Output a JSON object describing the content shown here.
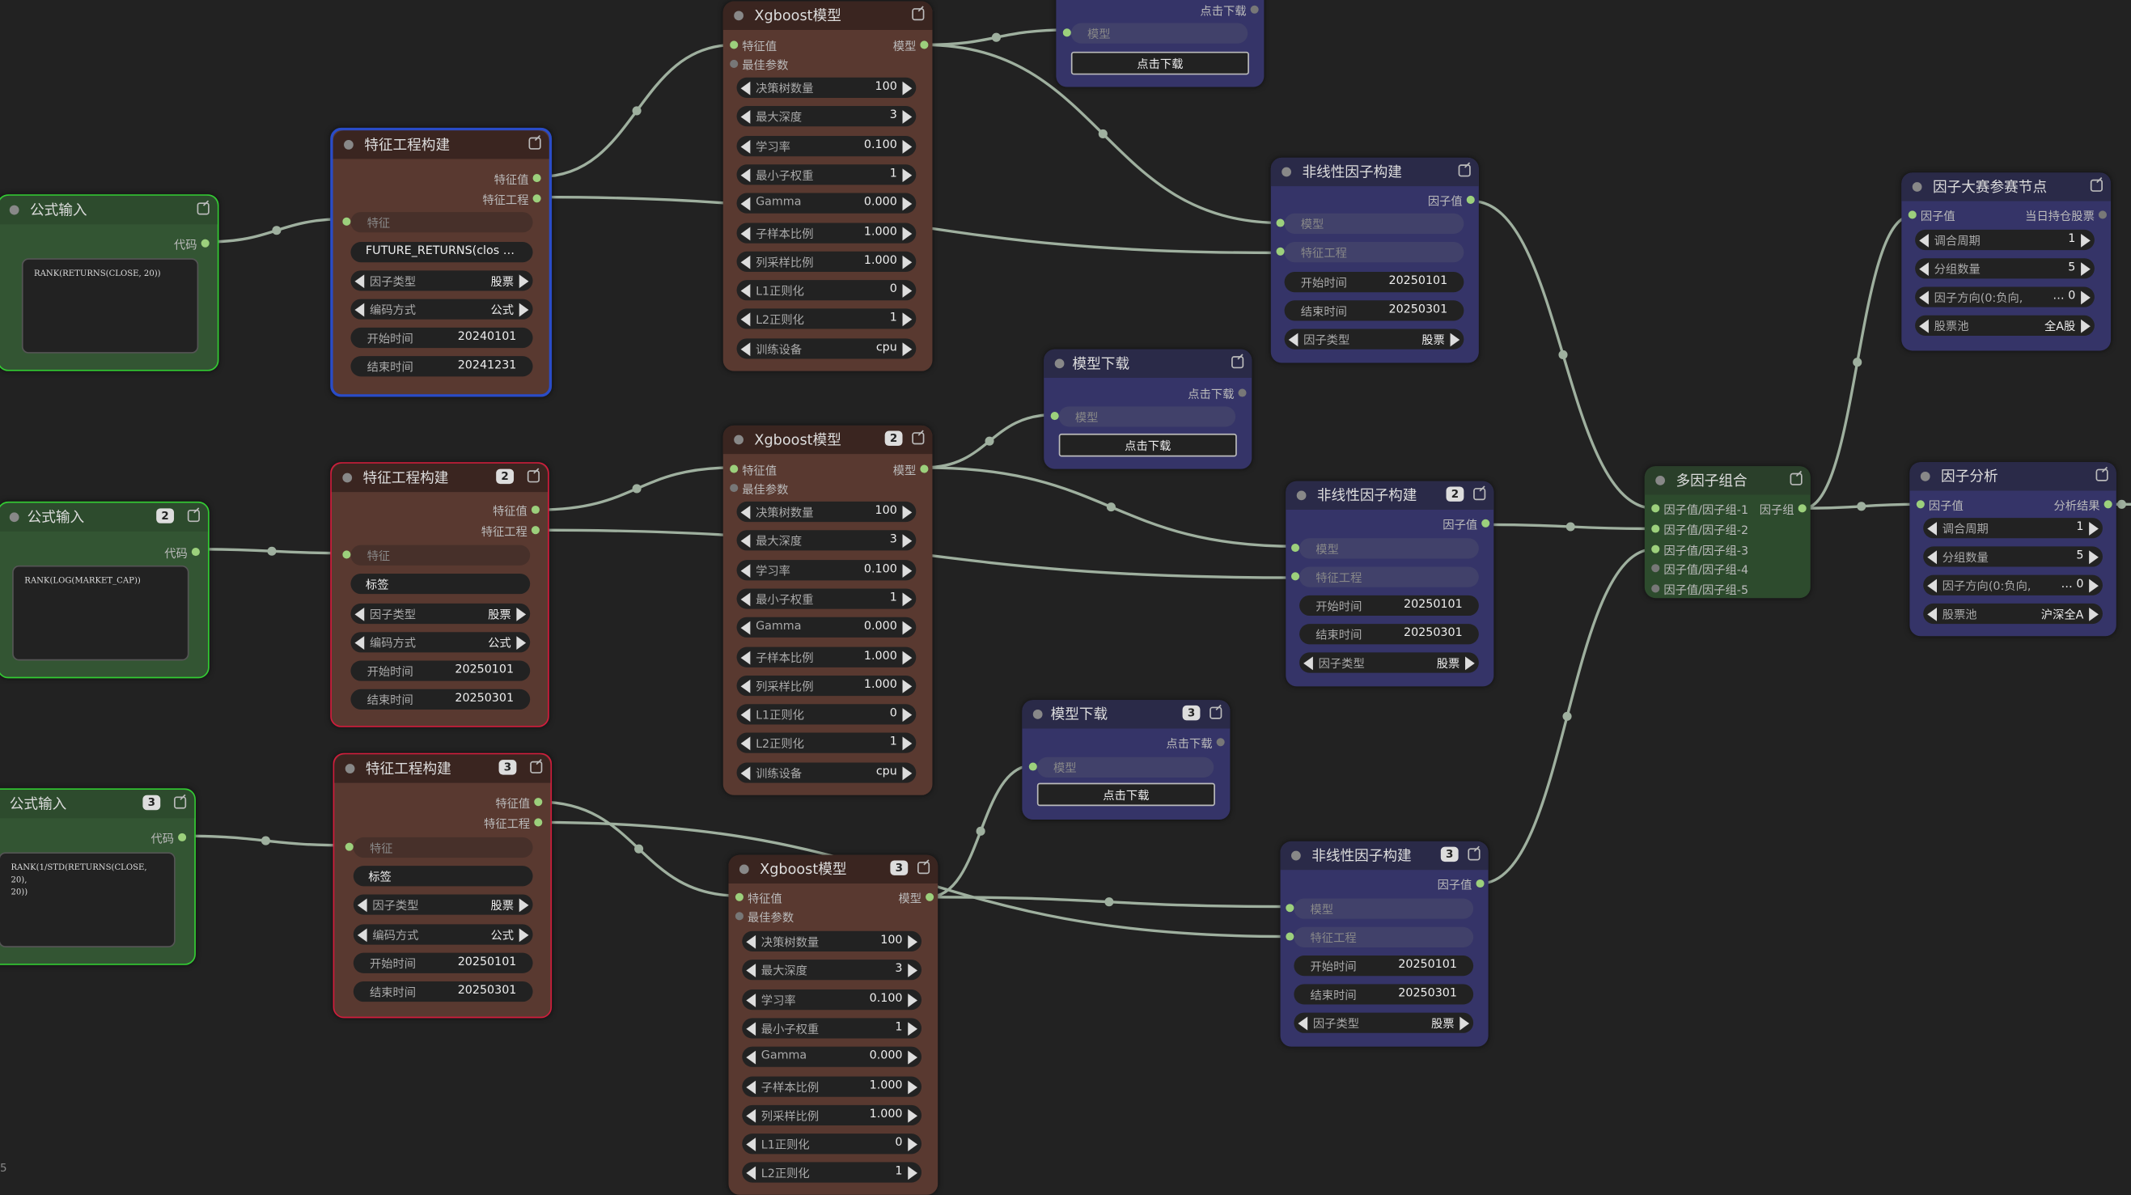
{
  "nodes": {
    "formula1": {
      "title": "公式输入",
      "out_code": "代码",
      "code": "RANK(RETURNS(CLOSE, 20))"
    },
    "formula2": {
      "title": "公式输入",
      "badge": "2",
      "out_code": "代码",
      "code": "RANK(LOG(MARKET_CAP))"
    },
    "formula3": {
      "title": "公式输入",
      "badge": "3",
      "out_code": "代码",
      "code": "RANK(1/STD(RETURNS(CLOSE, 20),\n20))"
    },
    "fe1": {
      "title": "特征工程构建",
      "out_feature": "特征值",
      "out_eng": "特征工程",
      "in_feature": "特征",
      "label_value": "FUTURE_RETURNS(clos …",
      "w_type_label": "因子类型",
      "w_type_value": "股票",
      "w_enc_label": "编码方式",
      "w_enc_value": "公式",
      "w_start_label": "开始时间",
      "w_start_value": "20240101",
      "w_end_label": "结束时间",
      "w_end_value": "20241231"
    },
    "fe2": {
      "title": "特征工程构建",
      "badge": "2",
      "out_feature": "特征值",
      "out_eng": "特征工程",
      "in_feature": "特征",
      "label_value": "标签",
      "w_type_label": "因子类型",
      "w_type_value": "股票",
      "w_enc_label": "编码方式",
      "w_enc_value": "公式",
      "w_start_label": "开始时间",
      "w_start_value": "20250101",
      "w_end_label": "结束时间",
      "w_end_value": "20250301"
    },
    "fe3": {
      "title": "特征工程构建",
      "badge": "3",
      "out_feature": "特征值",
      "out_eng": "特征工程",
      "in_feature": "特征",
      "label_value": "标签",
      "w_type_label": "因子类型",
      "w_type_value": "股票",
      "w_enc_label": "编码方式",
      "w_enc_value": "公式",
      "w_start_label": "开始时间",
      "w_start_value": "20250101",
      "w_end_label": "结束时间",
      "w_end_value": "20250301"
    },
    "xgb1": {
      "title": "Xgboost模型",
      "in_feature": "特征值",
      "in_best": "最佳参数",
      "out_model": "模型",
      "params": [
        {
          "label": "决策树数量",
          "value": "100"
        },
        {
          "label": "最大深度",
          "value": "3"
        },
        {
          "label": "学习率",
          "value": "0.100"
        },
        {
          "label": "最小子权重",
          "value": "1"
        },
        {
          "label": "Gamma",
          "value": "0.000"
        },
        {
          "label": "子样本比例",
          "value": "1.000"
        },
        {
          "label": "列采样比例",
          "value": "1.000"
        },
        {
          "label": "L1正则化",
          "value": "0"
        },
        {
          "label": "L2正则化",
          "value": "1"
        },
        {
          "label": "训练设备",
          "value": "cpu"
        }
      ]
    },
    "xgb2": {
      "title": "Xgboost模型",
      "badge": "2",
      "in_feature": "特征值",
      "in_best": "最佳参数",
      "out_model": "模型",
      "params": [
        {
          "label": "决策树数量",
          "value": "100"
        },
        {
          "label": "最大深度",
          "value": "3"
        },
        {
          "label": "学习率",
          "value": "0.100"
        },
        {
          "label": "最小子权重",
          "value": "1"
        },
        {
          "label": "Gamma",
          "value": "0.000"
        },
        {
          "label": "子样本比例",
          "value": "1.000"
        },
        {
          "label": "列采样比例",
          "value": "1.000"
        },
        {
          "label": "L1正则化",
          "value": "0"
        },
        {
          "label": "L2正则化",
          "value": "1"
        },
        {
          "label": "训练设备",
          "value": "cpu"
        }
      ]
    },
    "xgb3": {
      "title": "Xgboost模型",
      "badge": "3",
      "in_feature": "特征值",
      "in_best": "最佳参数",
      "out_model": "模型",
      "params": [
        {
          "label": "决策树数量",
          "value": "100"
        },
        {
          "label": "最大深度",
          "value": "3"
        },
        {
          "label": "学习率",
          "value": "0.100"
        },
        {
          "label": "最小子权重",
          "value": "1"
        },
        {
          "label": "Gamma",
          "value": "0.000"
        },
        {
          "label": "子样本比例",
          "value": "1.000"
        },
        {
          "label": "列采样比例",
          "value": "1.000"
        },
        {
          "label": "L1正则化",
          "value": "0"
        },
        {
          "label": "L2正则化",
          "value": "1"
        }
      ]
    },
    "dl1": {
      "out_download": "点击下载",
      "in_model": "模型",
      "button": "点击下载"
    },
    "dl2": {
      "title": "模型下载",
      "out_download": "点击下载",
      "in_model": "模型",
      "button": "点击下载"
    },
    "dl3": {
      "title": "模型下载",
      "badge": "3",
      "out_download": "点击下载",
      "in_model": "模型",
      "button": "点击下载"
    },
    "nl1": {
      "title": "非线性因子构建",
      "out_factor": "因子值",
      "in_model": "模型",
      "in_eng": "特征工程",
      "w_start_label": "开始时间",
      "w_start_value": "20250101",
      "w_end_label": "结束时间",
      "w_end_value": "20250301",
      "w_type_label": "因子类型",
      "w_type_value": "股票"
    },
    "nl2": {
      "title": "非线性因子构建",
      "badge": "2",
      "out_factor": "因子值",
      "in_model": "模型",
      "in_eng": "特征工程",
      "w_start_label": "开始时间",
      "w_start_value": "20250101",
      "w_end_label": "结束时间",
      "w_end_value": "20250301",
      "w_type_label": "因子类型",
      "w_type_value": "股票"
    },
    "nl3": {
      "title": "非线性因子构建",
      "badge": "3",
      "out_factor": "因子值",
      "in_model": "模型",
      "in_eng": "特征工程",
      "w_start_label": "开始时间",
      "w_start_value": "20250101",
      "w_end_label": "结束时间",
      "w_end_value": "20250301",
      "w_type_label": "因子类型",
      "w_type_value": "股票"
    },
    "multi": {
      "title": "多因子组合",
      "in1": "因子值/因子组-1",
      "in2": "因子值/因子组-2",
      "in3": "因子值/因子组-3",
      "in4": "因子值/因子组-4",
      "in5": "因子值/因子组-5",
      "out": "因子组"
    },
    "contest": {
      "title": "因子大赛参赛节点",
      "in_factor": "因子值",
      "out_hold": "当日持仓股票",
      "w_period_label": "调合周期",
      "w_period_value": "1",
      "w_groups_label": "分组数量",
      "w_groups_value": "5",
      "w_dir_label": "因子方向(0:负向,",
      "w_dir_value": "… 0",
      "w_pool_label": "股票池",
      "w_pool_value": "全A股"
    },
    "analysis": {
      "title": "因子分析",
      "in_factor": "因子值",
      "out_result": "分析结果",
      "w_period_label": "调合周期",
      "w_period_value": "1",
      "w_groups_label": "分组数量",
      "w_groups_value": "5",
      "w_dir_label": "因子方向(0:负向,",
      "w_dir_value": "… 0",
      "w_pool_label": "股票池",
      "w_pool_value": "沪深全A"
    }
  },
  "corner_text": "5",
  "colors": {
    "canvas": "#222222",
    "link": "#9fb09f",
    "port_on": "#9cd07c",
    "selected": "#2a4cc7",
    "error": "#d21c3c",
    "formula_border": "#33cc33"
  }
}
